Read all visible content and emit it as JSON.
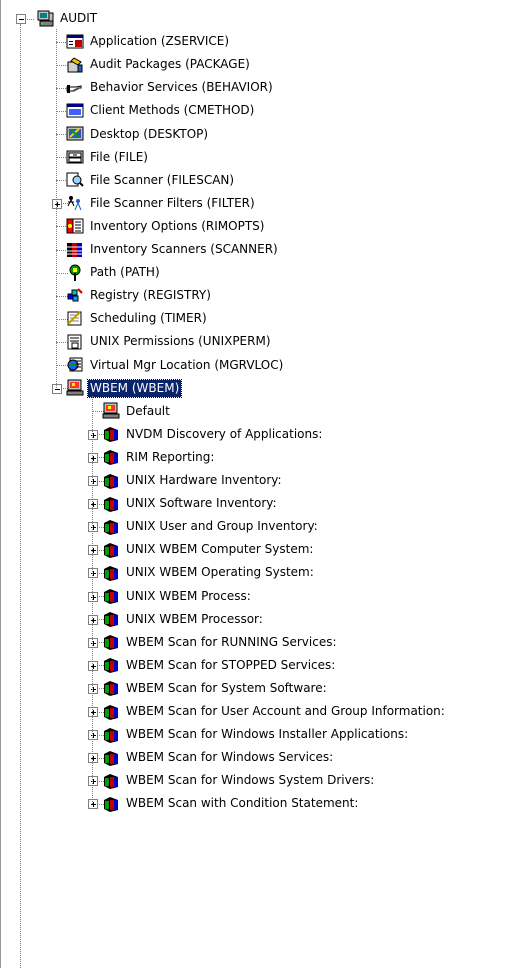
{
  "tree": {
    "root": {
      "label": "AUDIT",
      "icon": "server-computer-icon",
      "expanded": true
    },
    "children": [
      {
        "label": "Application (ZSERVICE)",
        "icon": "application-window-icon",
        "expandable": false
      },
      {
        "label": "Audit Packages (PACKAGE)",
        "icon": "package-icon",
        "expandable": false
      },
      {
        "label": "Behavior Services (BEHAVIOR)",
        "icon": "pointing-hand-icon",
        "expandable": false
      },
      {
        "label": "Client Methods (CMETHOD)",
        "icon": "client-window-icon",
        "expandable": false
      },
      {
        "label": "Desktop (DESKTOP)",
        "icon": "desktop-tools-icon",
        "expandable": false
      },
      {
        "label": "File (FILE)",
        "icon": "file-cabinet-icon",
        "expandable": false
      },
      {
        "label": "File Scanner (FILESCAN)",
        "icon": "magnifier-icon",
        "expandable": false
      },
      {
        "label": "File Scanner Filters (FILTER)",
        "icon": "filter-figures-icon",
        "expandable": true
      },
      {
        "label": "Inventory Options (RIMOPTS)",
        "icon": "options-icon",
        "expandable": false
      },
      {
        "label": "Inventory Scanners (SCANNER)",
        "icon": "scanner-icon",
        "expandable": false
      },
      {
        "label": "Path (PATH)",
        "icon": "path-arrow-icon",
        "expandable": false
      },
      {
        "label": "Registry (REGISTRY)",
        "icon": "registry-icon",
        "expandable": false
      },
      {
        "label": "Scheduling (TIMER)",
        "icon": "scheduling-icon",
        "expandable": false
      },
      {
        "label": "UNIX Permissions (UNIXPERM)",
        "icon": "unix-permissions-icon",
        "expandable": false
      },
      {
        "label": "Virtual Mgr Location (MGRVLOC)",
        "icon": "virtual-manager-icon",
        "expandable": false
      },
      {
        "label": "WBEM (WBEM)",
        "icon": "wbem-computer-icon",
        "expandable": true,
        "expanded": true,
        "selected": true
      }
    ],
    "wbem_children": [
      {
        "label": "Default",
        "icon": "default-computer-icon",
        "expandable": false
      },
      {
        "label": "NVDM Discovery of Applications:",
        "icon": "instance-cube-icon",
        "expandable": true
      },
      {
        "label": "RIM Reporting:",
        "icon": "instance-cube-icon",
        "expandable": true
      },
      {
        "label": "UNIX Hardware Inventory:",
        "icon": "instance-cube-icon",
        "expandable": true
      },
      {
        "label": "UNIX Software Inventory:",
        "icon": "instance-cube-icon",
        "expandable": true
      },
      {
        "label": "UNIX User and Group Inventory:",
        "icon": "instance-cube-icon",
        "expandable": true
      },
      {
        "label": "UNIX WBEM Computer System:",
        "icon": "instance-cube-icon",
        "expandable": true
      },
      {
        "label": "UNIX WBEM Operating System:",
        "icon": "instance-cube-icon",
        "expandable": true
      },
      {
        "label": "UNIX WBEM Process:",
        "icon": "instance-cube-icon",
        "expandable": true
      },
      {
        "label": "UNIX WBEM Processor:",
        "icon": "instance-cube-icon",
        "expandable": true
      },
      {
        "label": "WBEM Scan for RUNNING Services:",
        "icon": "instance-cube-icon",
        "expandable": true
      },
      {
        "label": "WBEM Scan for STOPPED Services:",
        "icon": "instance-cube-icon",
        "expandable": true
      },
      {
        "label": "WBEM Scan for System Software:",
        "icon": "instance-cube-icon",
        "expandable": true
      },
      {
        "label": "WBEM Scan for User Account and Group Information:",
        "icon": "instance-cube-icon",
        "expandable": true
      },
      {
        "label": "WBEM Scan for Windows Installer Applications:",
        "icon": "instance-cube-icon",
        "expandable": true
      },
      {
        "label": "WBEM Scan for Windows Services:",
        "icon": "instance-cube-icon",
        "expandable": true
      },
      {
        "label": "WBEM Scan for Windows System Drivers:",
        "icon": "instance-cube-icon",
        "expandable": true
      },
      {
        "label": "WBEM Scan with Condition Statement:",
        "icon": "instance-cube-icon",
        "expandable": true
      }
    ]
  }
}
